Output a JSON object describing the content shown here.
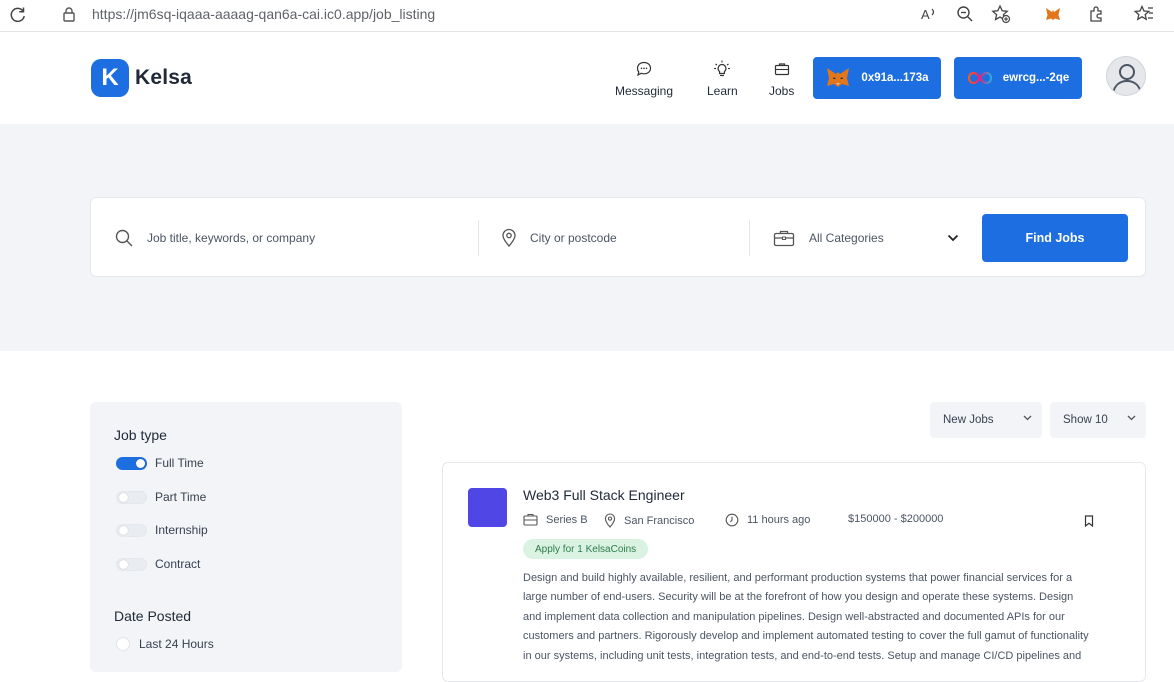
{
  "browser": {
    "url": "https://jm6sq-iqaaa-aaaag-qan6a-cai.ic0.app/job_listing"
  },
  "header": {
    "logo_letter": "K",
    "logo_text": "Kelsa",
    "nav": [
      {
        "label": "Messaging"
      },
      {
        "label": "Learn"
      },
      {
        "label": "Jobs"
      }
    ],
    "wallets": [
      {
        "label": "0x91a...173a"
      },
      {
        "label": "ewrcg...-2qe"
      }
    ]
  },
  "search": {
    "keyword_placeholder": "Job title, keywords, or company",
    "location_placeholder": "City or postcode",
    "category_selected": "All Categories",
    "find_label": "Find Jobs"
  },
  "filters": {
    "job_type_title": "Job type",
    "job_types": [
      {
        "label": "Full Time",
        "on": true
      },
      {
        "label": "Part Time",
        "on": false
      },
      {
        "label": "Internship",
        "on": false
      },
      {
        "label": "Contract",
        "on": false
      }
    ],
    "date_posted_title": "Date Posted",
    "date_options": [
      {
        "label": "Last 24 Hours"
      }
    ]
  },
  "sort": {
    "order_selected": "New Jobs",
    "show_selected": "Show 10"
  },
  "jobs": [
    {
      "title": "Web3 Full Stack Engineer",
      "stage": "Series B",
      "location": "San Francisco",
      "posted": "11 hours ago",
      "salary": "$150000 - $200000",
      "badge": "Apply for 1 KelsaCoins",
      "description_lines": [
        "Design and build highly available, resilient, and performant production systems that power financial services for a",
        "large number of end-users. Security will be at the forefront of how you design and operate these systems. Design",
        "and implement data collection and manipulation pipelines. Design well-abstracted and documented APIs for our",
        "customers and partners. Rigorously develop and implement automated testing to cover the full gamut of functionality",
        "in our systems, including unit tests, integration tests, and end-to-end tests. Setup and manage CI/CD pipelines and"
      ]
    }
  ],
  "colors": {
    "primary": "#1d6ee0",
    "hero_bg": "#f2f4f7",
    "badge_bg": "#d9f2e2",
    "company_logo": "#4f46e5"
  }
}
